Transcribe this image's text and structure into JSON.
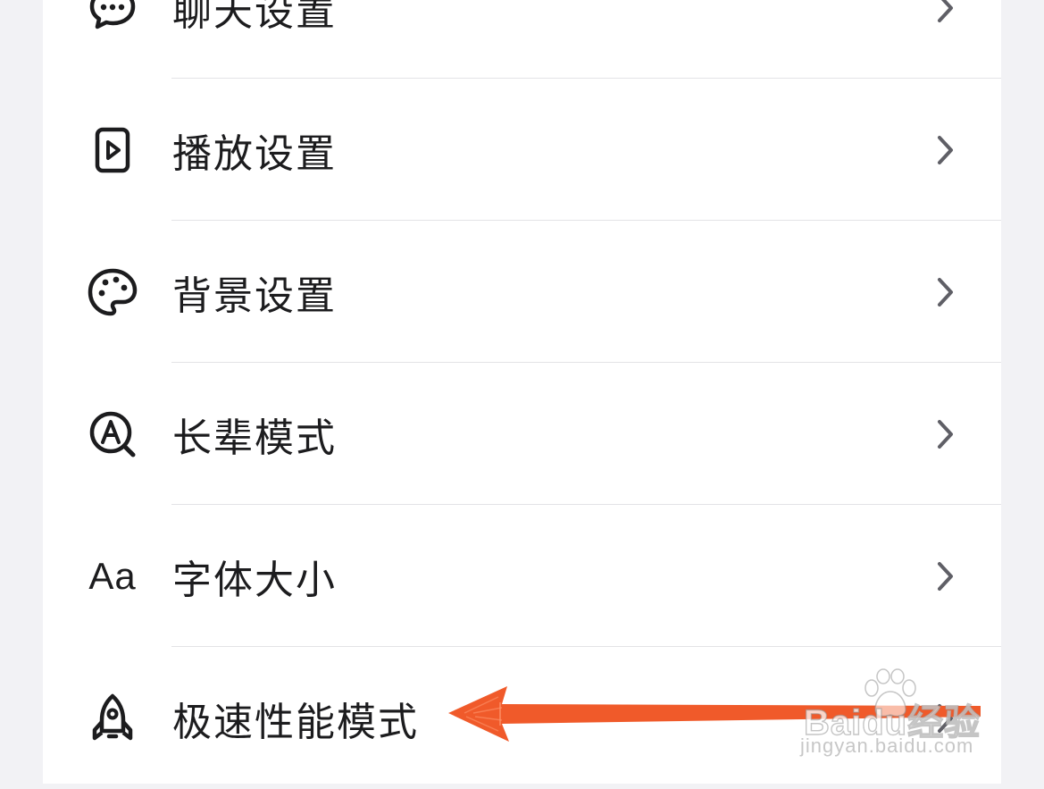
{
  "settings": {
    "items": [
      {
        "label": "聊天设置",
        "icon": "chat-bubble-icon"
      },
      {
        "label": "播放设置",
        "icon": "play-icon"
      },
      {
        "label": "背景设置",
        "icon": "palette-icon"
      },
      {
        "label": "长辈模式",
        "icon": "elder-mode-icon"
      },
      {
        "label": "字体大小",
        "icon": "font-size-icon",
        "icon_text": "Aa"
      },
      {
        "label": "极速性能模式",
        "icon": "rocket-icon"
      }
    ]
  },
  "annotation": {
    "arrow_color": "#f05a2a"
  },
  "watermark": {
    "logo_text": "Baidu经验",
    "url_text": "jingyan.baidu.com"
  },
  "colors": {
    "background": "#f2f2f5",
    "card": "#ffffff",
    "text": "#1c1c1e",
    "chevron": "#5f5f66",
    "divider": "#e3e3e6"
  }
}
